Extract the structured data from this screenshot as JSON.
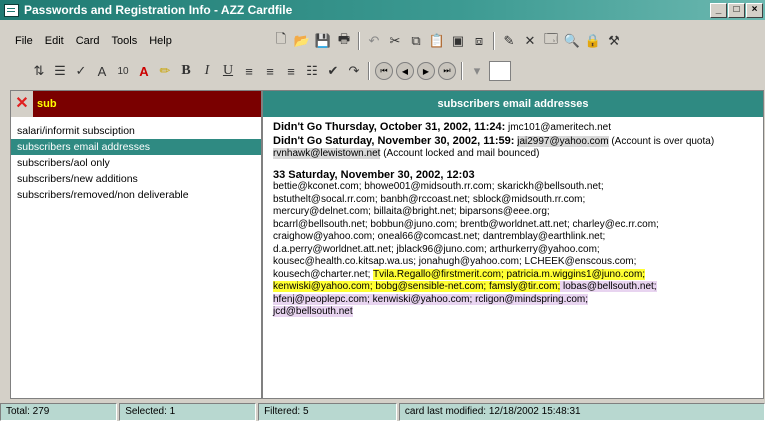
{
  "window": {
    "title": "Passwords and Registration Info - AZZ Cardfile"
  },
  "menu": [
    "File",
    "Edit",
    "Card",
    "Tools",
    "Help"
  ],
  "toolbar": {
    "font_size": "10",
    "color_hex": "#cc0000"
  },
  "search": {
    "value": "sub"
  },
  "list": {
    "items": [
      "salari/informit subsciption",
      "subscribers email addresses",
      "subscribers/aol only",
      "subscribers/new additions",
      "subscribers/removed/non deliverable"
    ],
    "selected_index": 1
  },
  "card": {
    "title": "subscribers email addresses",
    "line1_head": "Didn't Go Thursday, October 31, 2002, 11:24:",
    "line1_rest": " jmc101@ameritech.net",
    "line2_head": "Didn't Go Saturday, November 30, 2002, 11:59:",
    "line2_email": "jai2997@yahoo.com",
    "line2_rest": " (Account is over quota)",
    "line3_email": "rvnhawk@lewistown.net",
    "line3_rest": " (Account locked and mail bounced)",
    "block_head": "33  Saturday, November 30, 2002, 12:03",
    "block_lines": [
      "bettie@kconet.com; bhowe001@midsouth.rr.com; skarickh@bellsouth.net;",
      "bstuthelt@socal.rr.com; banbh@rccoast.net; sblock@midsouth.rr.com;",
      "mercury@delnet.com; billaita@bright.net; biparsons@eee.org;",
      "bcarrl@bellsouth.net; bobbun@juno.com; brentb@worldnet.att.net; charley@ec.rr.com;",
      "craighow@yahoo.com; oneal66@comcast.net; dantremblay@earthlink.net;",
      "d.a.perry@worldnet.att.net; jblack96@juno.com; arthurkerry@yahoo.com;",
      "kousec@health.co.kitsap.wa.us; jonahugh@yahoo.com; LCHEEK@enscous.com;"
    ],
    "hl_line1_a": "kousech@charter.net; ",
    "hl_line1_b": "Tvila.Regallo@firstmerit.com; patricia.m.wiggins1@juno.com;",
    "hl_line2_a": "kenwiski@yahoo.com; bobg@sensible-net.com; famsly@tir.com;",
    "hl_line2_b": " lobas@bellsouth.net;",
    "hl_line3": "hfenj@peoplepc.com; kenwiski@yahoo.com; rcligon@mindspring.com;",
    "hl_line4": "jcd@bellsouth.net"
  },
  "status": {
    "total": "Total: 279",
    "selected": "Selected: 1",
    "filtered": "Filtered: 5",
    "modified": "card last modified: 12/18/2002  15:48:31"
  }
}
